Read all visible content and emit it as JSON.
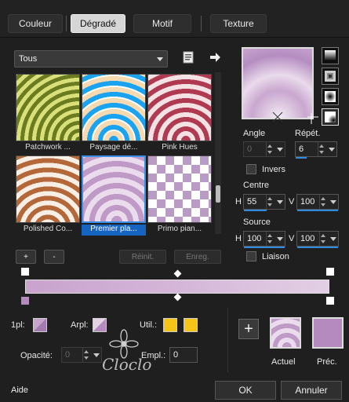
{
  "tabs": [
    {
      "label": "Couleur"
    },
    {
      "label": "Dégradé"
    },
    {
      "label": "Motif"
    },
    {
      "label": "Texture"
    }
  ],
  "category_select": {
    "value": "Tous"
  },
  "gradients": [
    {
      "name": "Patchwork ..."
    },
    {
      "name": "Paysage dé..."
    },
    {
      "name": "Pink Hues"
    },
    {
      "name": "Polished Co..."
    },
    {
      "name": "Premier pla..."
    },
    {
      "name": "Primo pian..."
    }
  ],
  "list_buttons": {
    "add": "+",
    "remove": "-",
    "reset": "Réinit.",
    "save": "Enreg."
  },
  "angle": {
    "label": "Angle",
    "value": "0"
  },
  "repeat": {
    "label": "Répét.",
    "value": "6"
  },
  "invert": {
    "label": "Invers"
  },
  "center": {
    "label": "Centre",
    "h_label": "H",
    "h_value": "55",
    "v_label": "V",
    "v_value": "100"
  },
  "source": {
    "label": "Source",
    "h_label": "H",
    "h_value": "100",
    "v_label": "V",
    "v_value": "100"
  },
  "link": {
    "label": "Liaison"
  },
  "bottom": {
    "front_label": "1pl:",
    "back_label": "Arpl:",
    "user_label": "Util.:",
    "opacity_label": "Opacité:",
    "opacity_value": "0",
    "location_label": "Empl.:",
    "location_value": "0"
  },
  "result": {
    "current_label": "Actuel",
    "previous_label": "Préc."
  },
  "watermark": "Cloclo",
  "footer": {
    "help": "Aide",
    "ok": "OK",
    "cancel": "Annuler"
  },
  "colors": {
    "accent": "#2f8ae0",
    "user_swatch": "#f5c518",
    "gradient_main": "#c8a3cd",
    "previous": "#b58bbf"
  }
}
